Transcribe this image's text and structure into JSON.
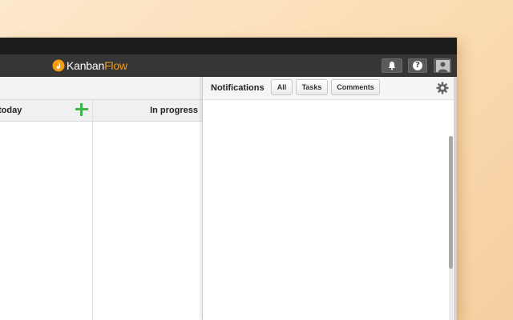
{
  "app": {
    "logo_part1": "Kanban",
    "logo_part2": "Flow",
    "brand_color": "#f39c12"
  },
  "header": {
    "buttons": [
      {
        "name": "notifications",
        "icon": "bell-icon"
      },
      {
        "name": "help",
        "icon": "help-icon",
        "label": "?"
      },
      {
        "name": "user",
        "icon": "avatar"
      }
    ]
  },
  "board": {
    "columns": [
      {
        "title": "today",
        "add_icon": "plus-icon",
        "add_color": "#3cb54a"
      },
      {
        "title": "In progress"
      }
    ]
  },
  "notifications": {
    "title": "Notifications",
    "tabs": [
      {
        "label": "All"
      },
      {
        "label": "Tasks"
      },
      {
        "label": "Comments"
      }
    ],
    "settings_icon": "gear-icon",
    "scroll_fraction_visible": 0.72
  }
}
